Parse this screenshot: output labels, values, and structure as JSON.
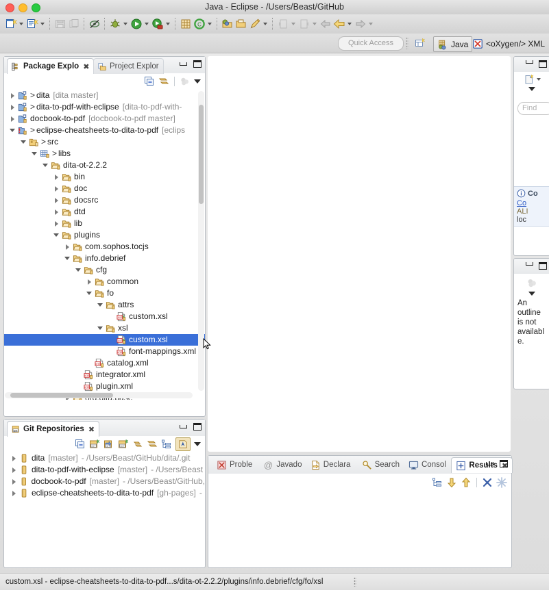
{
  "window": {
    "title": "Java - Eclipse - /Users/Beast/GitHub",
    "traffic_lights": [
      "close",
      "minimize",
      "zoom"
    ]
  },
  "toolbar": {
    "items": [
      {
        "name": "new-wizard",
        "icon": "new-file-icon",
        "dropdown": true,
        "enabled": true
      },
      {
        "name": "new-java-class",
        "icon": "new-class-icon",
        "dropdown": true,
        "enabled": true
      },
      {
        "name": "save",
        "icon": "save-icon",
        "dropdown": false,
        "enabled": false
      },
      {
        "name": "print",
        "icon": "print-icon",
        "dropdown": false,
        "enabled": false
      },
      {
        "name": "toggle-breakpoints",
        "icon": "skip-breakpoints-icon",
        "dropdown": false,
        "enabled": true
      },
      {
        "name": "debug",
        "icon": "debug-bug-icon",
        "dropdown": true,
        "enabled": true
      },
      {
        "name": "run",
        "icon": "run-green-arrow-icon",
        "dropdown": true,
        "enabled": true
      },
      {
        "name": "run-external-tools",
        "icon": "external-tools-icon",
        "dropdown": true,
        "enabled": true
      },
      {
        "name": "new-java-project",
        "icon": "new-java-project-icon",
        "dropdown": false,
        "enabled": true
      },
      {
        "name": "open-type",
        "icon": "open-type-icon",
        "dropdown": true,
        "enabled": true
      },
      {
        "name": "open-task",
        "icon": "open-task-icon",
        "dropdown": false,
        "enabled": true
      },
      {
        "name": "open-folder",
        "icon": "open-folder-icon",
        "dropdown": false,
        "enabled": true
      },
      {
        "name": "edit-key",
        "icon": "pencil-key-icon",
        "dropdown": true,
        "enabled": true
      },
      {
        "name": "next-annotation",
        "icon": "next-annotation-icon",
        "dropdown": true,
        "enabled": false
      },
      {
        "name": "previous-annotation",
        "icon": "prev-annotation-icon",
        "dropdown": true,
        "enabled": false
      },
      {
        "name": "back",
        "icon": "back-arrow-icon",
        "dropdown": false,
        "enabled": false
      },
      {
        "name": "previous-edit-location",
        "icon": "yellow-left-arrow-icon",
        "dropdown": true,
        "enabled": true
      },
      {
        "name": "forward",
        "icon": "forward-arrow-icon",
        "dropdown": true,
        "enabled": false
      }
    ]
  },
  "quick_access": {
    "placeholder": "Quick Access"
  },
  "perspectives": {
    "open_perspective_tooltip": "Open Perspective",
    "items": [
      {
        "label": "Java",
        "icon": "java-perspective-icon",
        "active": true
      },
      {
        "label": "<oXygen/> XML",
        "icon": "oxygen-xml-icon",
        "active": false
      }
    ]
  },
  "package_explorer": {
    "tabs": [
      {
        "label": "Package Explo",
        "icon": "package-explorer-icon",
        "selected": true,
        "closable": true
      },
      {
        "label": "Project Explor",
        "icon": "project-explorer-icon",
        "selected": false,
        "closable": false
      }
    ],
    "view_toolbar": [
      {
        "name": "collapse-all",
        "icon": "collapse-all-icon"
      },
      {
        "name": "link-with-editor",
        "icon": "link-editor-icon"
      },
      {
        "name": "focus-on-active-task",
        "icon": "focus-task-icon"
      },
      {
        "name": "view-menu",
        "icon": "view-menu-icon"
      }
    ],
    "tree": [
      {
        "indent": 0,
        "arrow": "closed",
        "icon": "java-project-icon",
        "prefix": "> ",
        "label": "dita",
        "dim": "[dita master]"
      },
      {
        "indent": 0,
        "arrow": "closed",
        "icon": "java-project-icon",
        "prefix": "> ",
        "label": "dita-to-pdf-with-eclipse",
        "dim": "[dita-to-pdf-with-"
      },
      {
        "indent": 0,
        "arrow": "closed",
        "icon": "java-project-icon",
        "prefix": "",
        "label": "docbook-to-pdf",
        "dim": "[docbook-to-pdf master]"
      },
      {
        "indent": 0,
        "arrow": "open",
        "icon": "java-project-error-icon",
        "prefix": "> ",
        "label": "eclipse-cheatsheets-to-dita-to-pdf",
        "dim": "[eclips"
      },
      {
        "indent": 1,
        "arrow": "open",
        "icon": "source-folder-icon",
        "prefix": "> ",
        "label": "src",
        "dim": ""
      },
      {
        "indent": 2,
        "arrow": "open",
        "icon": "package-icon",
        "prefix": "> ",
        "label": "libs",
        "dim": ""
      },
      {
        "indent": 3,
        "arrow": "open",
        "icon": "folder-icon",
        "prefix": "",
        "label": "dita-ot-2.2.2",
        "dim": ""
      },
      {
        "indent": 4,
        "arrow": "closed",
        "icon": "folder-icon",
        "prefix": "",
        "label": "bin",
        "dim": ""
      },
      {
        "indent": 4,
        "arrow": "closed",
        "icon": "folder-icon",
        "prefix": "",
        "label": "doc",
        "dim": ""
      },
      {
        "indent": 4,
        "arrow": "closed",
        "icon": "folder-icon",
        "prefix": "",
        "label": "docsrc",
        "dim": ""
      },
      {
        "indent": 4,
        "arrow": "closed",
        "icon": "folder-icon",
        "prefix": "",
        "label": "dtd",
        "dim": ""
      },
      {
        "indent": 4,
        "arrow": "closed",
        "icon": "folder-icon",
        "prefix": "",
        "label": "lib",
        "dim": ""
      },
      {
        "indent": 4,
        "arrow": "open",
        "icon": "folder-icon",
        "prefix": "",
        "label": "plugins",
        "dim": ""
      },
      {
        "indent": 5,
        "arrow": "closed",
        "icon": "folder-icon",
        "prefix": "",
        "label": "com.sophos.tocjs",
        "dim": ""
      },
      {
        "indent": 5,
        "arrow": "open",
        "icon": "folder-icon",
        "prefix": "",
        "label": "info.debrief",
        "dim": ""
      },
      {
        "indent": 6,
        "arrow": "open",
        "icon": "folder-icon",
        "prefix": "",
        "label": "cfg",
        "dim": ""
      },
      {
        "indent": 7,
        "arrow": "closed",
        "icon": "folder-icon",
        "prefix": "",
        "label": "common",
        "dim": ""
      },
      {
        "indent": 7,
        "arrow": "open",
        "icon": "folder-icon",
        "prefix": "",
        "label": "fo",
        "dim": ""
      },
      {
        "indent": 8,
        "arrow": "open",
        "icon": "folder-icon",
        "prefix": "",
        "label": "attrs",
        "dim": ""
      },
      {
        "indent": 9,
        "arrow": "none",
        "icon": "xsl-file-icon",
        "prefix": "",
        "label": "custom.xsl",
        "dim": ""
      },
      {
        "indent": 8,
        "arrow": "open",
        "icon": "folder-icon",
        "prefix": "",
        "label": "xsl",
        "dim": ""
      },
      {
        "indent": 9,
        "arrow": "none",
        "icon": "xsl-file-icon",
        "prefix": "",
        "label": "custom.xsl",
        "dim": "",
        "selected": true
      },
      {
        "indent": 9,
        "arrow": "none",
        "icon": "xml-file-icon",
        "prefix": "",
        "label": "font-mappings.xml",
        "dim": ""
      },
      {
        "indent": 7,
        "arrow": "none",
        "icon": "xml-file-icon",
        "prefix": "",
        "label": "catalog.xml",
        "dim": ""
      },
      {
        "indent": 6,
        "arrow": "none",
        "icon": "xml-file-icon",
        "prefix": "",
        "label": "integrator.xml",
        "dim": ""
      },
      {
        "indent": 6,
        "arrow": "none",
        "icon": "xml-file-icon",
        "prefix": "",
        "label": "plugin.xml",
        "dim": ""
      },
      {
        "indent": 5,
        "arrow": "closed",
        "icon": "folder-icon",
        "prefix": "",
        "label": "org.dita.base",
        "dim": ""
      }
    ]
  },
  "git_repositories": {
    "tab": {
      "label": "Git Repositories",
      "icon": "git-repo-icon",
      "closable": true
    },
    "view_toolbar": [
      {
        "name": "collapse-all",
        "icon": "collapse-all-icon"
      },
      {
        "name": "add-existing-repository",
        "icon": "git-add-icon"
      },
      {
        "name": "clone-repository",
        "icon": "git-clone-icon"
      },
      {
        "name": "create-repository",
        "icon": "git-create-icon"
      },
      {
        "name": "refresh",
        "icon": "refresh-icon"
      },
      {
        "name": "link-with-selection",
        "icon": "link-editor-icon"
      },
      {
        "name": "hierarchy-layout",
        "icon": "hierarchy-icon"
      },
      {
        "name": "toggle-branch-commit",
        "icon": "branch-commit-icon",
        "pressed": true
      },
      {
        "name": "view-menu",
        "icon": "view-menu-icon"
      }
    ],
    "rows": [
      {
        "label": "dita",
        "branch": "[master]",
        "path": "- /Users/Beast/GitHub/dita/.git"
      },
      {
        "label": "dita-to-pdf-with-eclipse",
        "branch": "[master]",
        "path": "- /Users/Beast"
      },
      {
        "label": "docbook-to-pdf",
        "branch": "[master]",
        "path": "- /Users/Beast/GitHub,"
      },
      {
        "label": "eclipse-cheatsheets-to-dita-to-pdf",
        "branch": "[gh-pages]",
        "path": "-"
      }
    ]
  },
  "bottom_views": {
    "tabs": [
      {
        "label": "Proble",
        "icon": "problems-icon",
        "selected": false
      },
      {
        "label": "Javado",
        "icon": "javadoc-icon",
        "selected": false
      },
      {
        "label": "Declara",
        "icon": "declaration-icon",
        "selected": false
      },
      {
        "label": "Search",
        "icon": "search-icon",
        "selected": false
      },
      {
        "label": "Consol",
        "icon": "console-icon",
        "selected": false
      },
      {
        "label": "Results",
        "icon": "results-icon",
        "selected": true,
        "closable": true
      }
    ],
    "view_toolbar": [
      {
        "name": "show-as-tree",
        "icon": "tree-layout-icon"
      },
      {
        "name": "next-failure",
        "icon": "down-arrow-icon"
      },
      {
        "name": "previous-failure",
        "icon": "up-arrow-icon"
      },
      {
        "name": "close-results",
        "icon": "close-x-icon"
      },
      {
        "name": "close-all-results",
        "icon": "close-all-icon"
      }
    ]
  },
  "right_panels": {
    "cheatsheet": {
      "new_button_tooltip": "New",
      "find_placeholder": "Find",
      "info_title": "Co",
      "info_link": "Co",
      "info_lines": [
        "ALI",
        "loc"
      ]
    },
    "outline": {
      "message": "An outline is not available.",
      "empty_icon": "outline-empty-icon"
    }
  },
  "status_bar": {
    "text": "custom.xsl - eclipse-cheatsheets-to-dita-to-pdf...s/dita-ot-2.2.2/plugins/info.debrief/cfg/fo/xsl"
  },
  "colors": {
    "selection_blue": "#3a6fd8",
    "chrome": "#e4e4e4",
    "panel_border": "#b9bec4",
    "dim_text": "#8c8c8c",
    "link": "#2b58c4"
  }
}
